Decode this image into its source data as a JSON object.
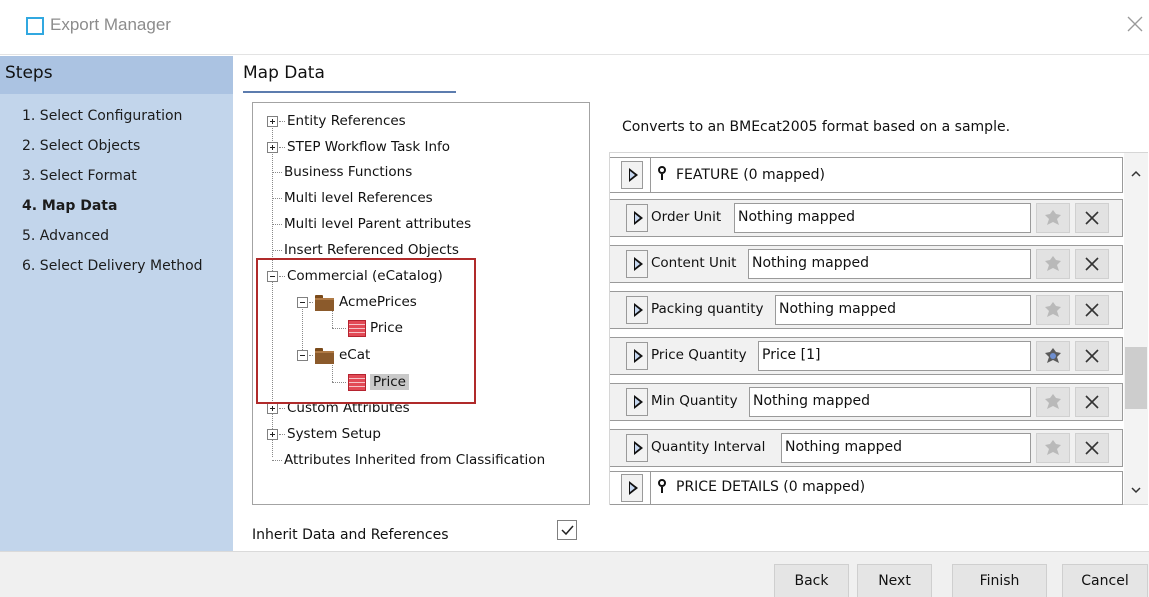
{
  "window": {
    "title": "Export Manager"
  },
  "sidebar": {
    "heading": "Steps",
    "steps": [
      {
        "label": "1. Select Configuration",
        "active": false
      },
      {
        "label": "2. Select Objects",
        "active": false
      },
      {
        "label": "3. Select Format",
        "active": false
      },
      {
        "label": "4. Map Data",
        "active": true
      },
      {
        "label": "5. Advanced",
        "active": false
      },
      {
        "label": "6. Select Delivery Method",
        "active": false
      }
    ]
  },
  "main": {
    "title": "Map Data",
    "description": "Converts to an BMEcat2005 format based on a sample.",
    "inherit_label": "Inherit Data and References",
    "inherit_checked": true
  },
  "tree": {
    "items": [
      {
        "label": "Entity References",
        "expander": "plus"
      },
      {
        "label": "STEP Workflow Task Info",
        "expander": "plus"
      },
      {
        "label": "Business Functions",
        "expander": "none"
      },
      {
        "label": "Multi level References",
        "expander": "none"
      },
      {
        "label": "Multi level Parent attributes",
        "expander": "none"
      },
      {
        "label": "Insert Referenced Objects",
        "expander": "none"
      },
      {
        "label": "Commercial (eCatalog)",
        "expander": "minus"
      },
      {
        "label": "AcmePrices",
        "expander": "minus",
        "icon": "folder-icon"
      },
      {
        "label": "Price",
        "icon": "price-icon"
      },
      {
        "label": "eCat",
        "expander": "minus",
        "icon": "folder-icon"
      },
      {
        "label": "Price",
        "icon": "price-icon",
        "selected": true
      },
      {
        "label": "Custom Attributes",
        "expander": "plus"
      },
      {
        "label": "System Setup",
        "expander": "plus"
      },
      {
        "label": "Attributes Inherited from Classification",
        "expander": "none"
      }
    ]
  },
  "mapping": {
    "groups": [
      {
        "label": "FEATURE (0 mapped)"
      },
      {
        "label": "PRICE DETAILS (0 mapped)"
      }
    ],
    "fields": [
      {
        "label": "Order Unit",
        "value": "Nothing mapped",
        "gear_active": false
      },
      {
        "label": "Content Unit",
        "value": "Nothing mapped",
        "gear_active": false
      },
      {
        "label": "Packing quantity",
        "value": "Nothing mapped",
        "gear_active": false
      },
      {
        "label": "Price Quantity",
        "value": "Price [1]",
        "gear_active": true
      },
      {
        "label": "Min Quantity",
        "value": "Nothing mapped",
        "gear_active": false
      },
      {
        "label": "Quantity Interval",
        "value": "Nothing mapped",
        "gear_active": false
      }
    ]
  },
  "buttons": {
    "back": "Back",
    "next": "Next",
    "finish": "Finish",
    "cancel": "Cancel"
  },
  "colors": {
    "sidebar_bg": "#c2d5eb",
    "sidebar_head_bg": "#abc3e2",
    "highlight_border": "#b02a2a",
    "app_icon": "#31a8e0"
  }
}
